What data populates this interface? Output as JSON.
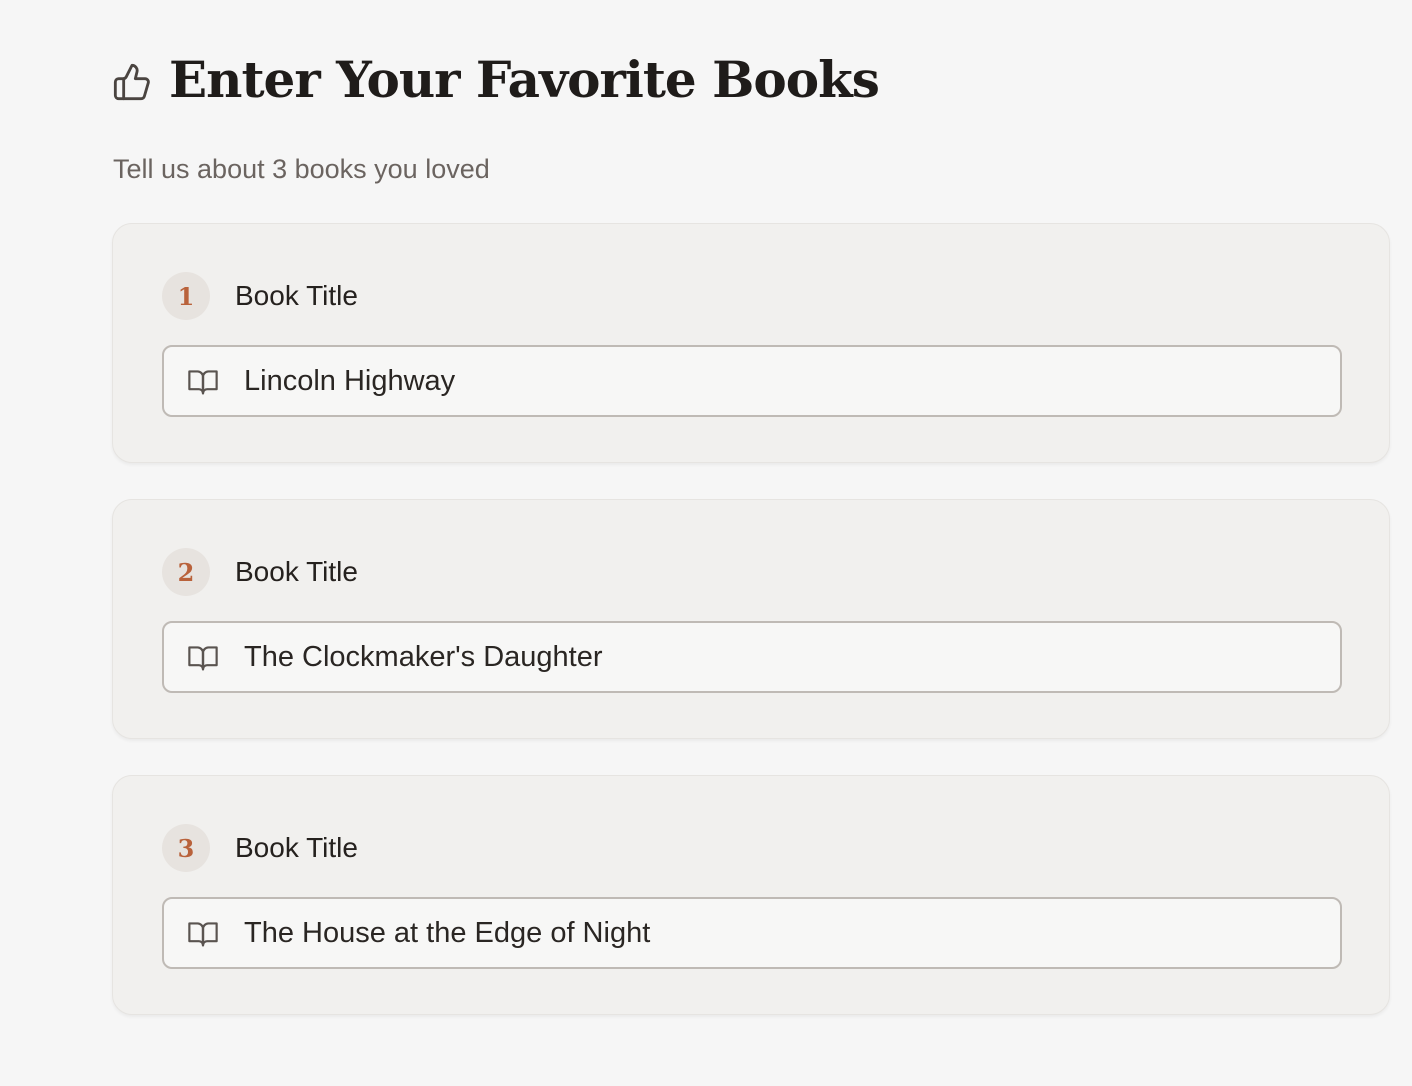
{
  "header": {
    "icon": "thumbs-up-icon",
    "title": "Enter Your Favorite Books",
    "subtitle": "Tell us about 3 books you loved"
  },
  "books": [
    {
      "number": "1",
      "label": "Book Title",
      "icon": "book-open-icon",
      "value": "Lincoln Highway"
    },
    {
      "number": "2",
      "label": "Book Title",
      "icon": "book-open-icon",
      "value": "The Clockmaker's Daughter"
    },
    {
      "number": "3",
      "label": "Book Title",
      "icon": "book-open-icon",
      "value": "The House at the Edge of Night"
    }
  ],
  "colors": {
    "accent": "#b9623b",
    "background": "#f6f6f6",
    "card": "#f1f0ee"
  }
}
